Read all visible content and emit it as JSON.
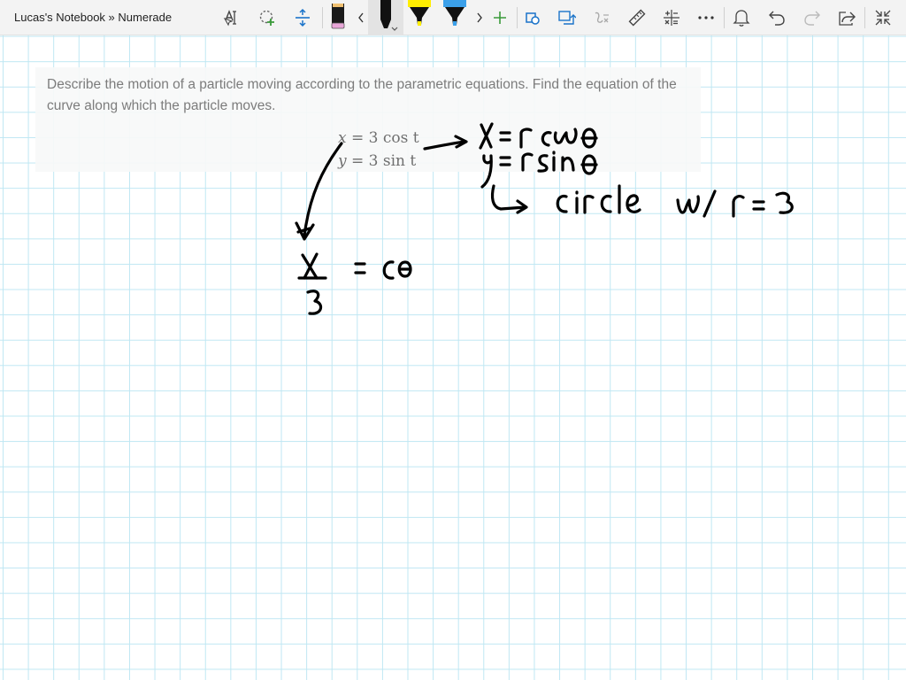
{
  "app": {
    "title": "Lucas's Notebook » Numerade"
  },
  "toolbar": {
    "buttons": [
      {
        "name": "text-select-tool",
        "icon": "text-cursor-icon"
      },
      {
        "name": "lasso-select-tool",
        "icon": "lasso-plus-icon"
      },
      {
        "name": "add-space-tool",
        "icon": "add-space-icon"
      },
      {
        "name": "pen-pink",
        "icon": "pen-icon",
        "color": "#e8a6d8"
      },
      {
        "name": "scroll-left",
        "icon": "chevron-left-icon"
      },
      {
        "name": "pen-black",
        "icon": "pen-icon",
        "color": "#111111",
        "selected": true
      },
      {
        "name": "highlighter-yellow",
        "icon": "highlighter-icon",
        "color": "#ffee00"
      },
      {
        "name": "highlighter-blue",
        "icon": "highlighter-icon",
        "color": "#3ba0ea"
      },
      {
        "name": "scroll-right",
        "icon": "chevron-right-icon"
      },
      {
        "name": "add-pen",
        "icon": "plus-icon"
      },
      {
        "name": "ink-to-shape",
        "icon": "shapes-icon"
      },
      {
        "name": "ink-to-text",
        "icon": "ink-to-text-icon"
      },
      {
        "name": "ink-to-math",
        "icon": "math-icon"
      },
      {
        "name": "ruler",
        "icon": "ruler-icon"
      },
      {
        "name": "math-tool",
        "icon": "math-symbols-icon"
      },
      {
        "name": "more-options",
        "icon": "ellipsis-icon"
      },
      {
        "name": "notifications",
        "icon": "bell-icon"
      },
      {
        "name": "undo",
        "icon": "undo-icon"
      },
      {
        "name": "redo",
        "icon": "redo-icon"
      },
      {
        "name": "share",
        "icon": "share-icon"
      },
      {
        "name": "fullscreen",
        "icon": "collapse-icon"
      }
    ],
    "accent_green": "#3a9a3a",
    "accent_blue": "#1a73c9"
  },
  "question": {
    "text": "Describe the motion of a particle moving according to the parametric equations. Find the equation of the curve along which the particle moves.",
    "equations": [
      {
        "lhs": "x",
        "rhs": "3 cos t"
      },
      {
        "lhs": "y",
        "rhs": "3 sin t"
      }
    ]
  },
  "handwriting": {
    "color": "#000000",
    "lines": [
      "x = r cos θ",
      "y = r sin θ",
      "↳ circle w/ r = 3",
      "x/3 = cos"
    ]
  }
}
